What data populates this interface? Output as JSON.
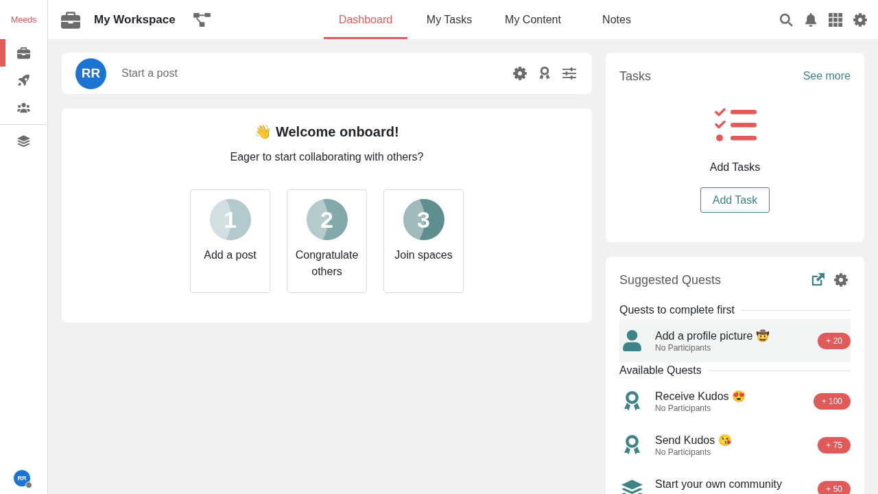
{
  "sidebar": {
    "logo": "Meeds",
    "sections": [
      {
        "items": [
          {
            "selected": true
          },
          {
            "selected": false
          },
          {
            "selected": false
          }
        ]
      },
      {
        "items": [
          {
            "selected": false
          }
        ]
      }
    ],
    "user": {
      "initials": "RR",
      "online": false
    }
  },
  "topbar": {
    "space_name": "My Workspace",
    "tabs": [
      {
        "label": "Dashboard",
        "selected": true
      },
      {
        "label": "My Tasks",
        "selected": false
      },
      {
        "label": "My Content",
        "selected": false
      },
      {
        "label": "Notes",
        "selected": false
      }
    ]
  },
  "composer": {
    "avatar": "RR",
    "prompt": "Start a post"
  },
  "welcome": {
    "title": "👋 Welcome onboard!",
    "subtitle": "Eager to start collaborating with others?",
    "steps": [
      {
        "number": "1",
        "label": "Add a post",
        "color": "#b2cacd"
      },
      {
        "number": "2",
        "label": "Congratulate others",
        "color": "#84a9ab"
      },
      {
        "number": "3",
        "label": "Join spaces",
        "color": "#5f8e90"
      }
    ]
  },
  "tasks": {
    "title": "Tasks",
    "link": "See more",
    "empty_label": "Add Tasks",
    "button": "Add Task"
  },
  "quests": {
    "title": "Suggested Quests",
    "sections": [
      {
        "title": "Quests to complete first",
        "items": [
          {
            "kind": "profile",
            "title": "Add a profile picture 🤠",
            "participants": "No Participants",
            "points": "+ 20",
            "highlighted": true
          }
        ]
      },
      {
        "title": "Available Quests",
        "items": [
          {
            "kind": "kudos",
            "title": "Receive Kudos 😍",
            "participants": "No Participants",
            "points": "+ 100",
            "highlighted": false
          },
          {
            "kind": "kudos",
            "title": "Send Kudos 😘",
            "participants": "No Participants",
            "points": "+ 75",
            "highlighted": false
          },
          {
            "kind": "space",
            "title": "Start your own community",
            "points": "+ 50",
            "highlighted": false
          }
        ]
      }
    ]
  }
}
